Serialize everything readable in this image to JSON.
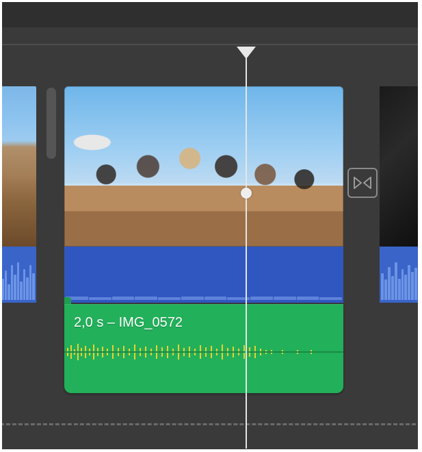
{
  "timeline": {
    "clip_left": {
      "duration_s": null,
      "name": null
    },
    "clip_center": {
      "duration_s": "2,0 s",
      "name": "IMG_0572",
      "attached_audio_label": "2,0 s – IMG_0572"
    },
    "clip_right": {
      "duration_s": null,
      "name": null
    },
    "transition_icon": "crossfade-icon"
  },
  "playhead": {
    "visible": true
  },
  "colors": {
    "video_track": "#3057c0",
    "audio_clip": "#22b05a",
    "background": "#3a3a3a"
  }
}
